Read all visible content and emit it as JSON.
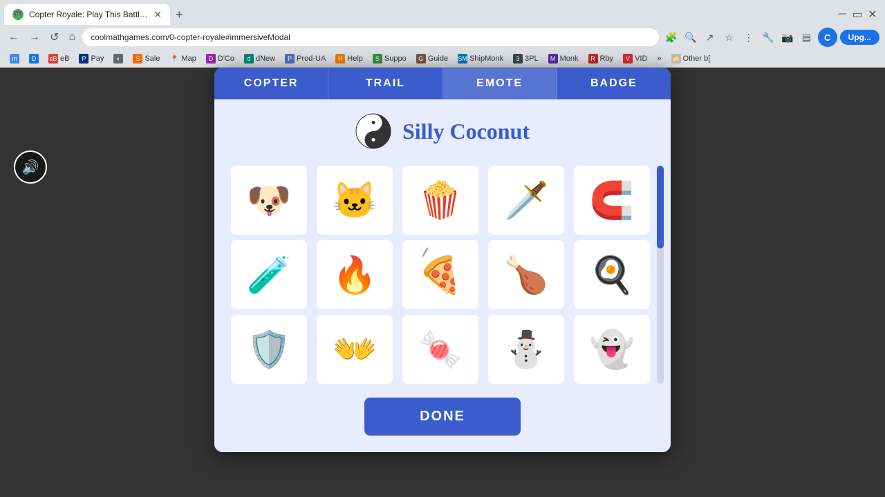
{
  "browser": {
    "tab_title": "Copter Royale: Play This Battle R...",
    "tab_favicon": "🎮",
    "address": "coolmathgames.com/0-copter-royale#immersiveModal",
    "new_tab_label": "+",
    "nav": {
      "back": "←",
      "forward": "→",
      "refresh": "↺",
      "home": "⌂"
    }
  },
  "bookmarks": [
    {
      "icon": "M",
      "label": ""
    },
    {
      "icon": "D",
      "label": ""
    },
    {
      "icon": "eB",
      "label": "eB"
    },
    {
      "icon": "P",
      "label": "Pay"
    },
    {
      "icon": "◐",
      "label": ""
    },
    {
      "icon": "S",
      "label": "Sale"
    },
    {
      "icon": "📍",
      "label": "Map"
    },
    {
      "icon": "D",
      "label": "D'Co"
    },
    {
      "icon": "dN",
      "label": "dNew"
    },
    {
      "icon": "P",
      "label": "Prod-UA"
    },
    {
      "icon": "H",
      "label": "Help"
    },
    {
      "icon": "S",
      "label": "Suppo"
    },
    {
      "icon": "G",
      "label": "Guide"
    },
    {
      "icon": "SM",
      "label": "ShipMonk"
    },
    {
      "icon": "3",
      "label": "3PL"
    },
    {
      "icon": "M",
      "label": "Monk"
    },
    {
      "icon": "R",
      "label": "Rby"
    },
    {
      "icon": "V",
      "label": "VID"
    },
    {
      "icon": "»",
      "label": "»"
    },
    {
      "icon": "B",
      "label": "Other b["
    }
  ],
  "modal": {
    "tabs": [
      {
        "id": "copter",
        "label": "COPTER"
      },
      {
        "id": "trail",
        "label": "TRAIL"
      },
      {
        "id": "emote",
        "label": "EMOTE",
        "active": true
      },
      {
        "id": "badge",
        "label": "BADGE"
      }
    ],
    "user": {
      "name": "Silly Coconut"
    },
    "emotes": [
      {
        "id": "dog",
        "emoji": "🐶"
      },
      {
        "id": "cat",
        "emoji": "🐱"
      },
      {
        "id": "popcorn",
        "emoji": "🍿"
      },
      {
        "id": "sword",
        "emoji": "🗡️"
      },
      {
        "id": "horseshoe",
        "emoji": "🧲"
      },
      {
        "id": "potion",
        "emoji": "🧪"
      },
      {
        "id": "campfire",
        "emoji": "🔥"
      },
      {
        "id": "pizza",
        "emoji": "🍕"
      },
      {
        "id": "drumstick",
        "emoji": "🍗"
      },
      {
        "id": "egg",
        "emoji": "🍳"
      },
      {
        "id": "shield",
        "emoji": "🛡️"
      },
      {
        "id": "clapping",
        "emoji": "👐"
      },
      {
        "id": "candy",
        "emoji": "🍬"
      },
      {
        "id": "snowman",
        "emoji": "⛄"
      },
      {
        "id": "ghost",
        "emoji": "👻"
      }
    ],
    "done_label": "DONE"
  },
  "sound_btn": "🔊",
  "colors": {
    "tab_active_bg": "#3a5ccc",
    "modal_bg": "#e8ecff",
    "username_color": "#3a5ccc",
    "done_btn_bg": "#3a5ccc"
  }
}
